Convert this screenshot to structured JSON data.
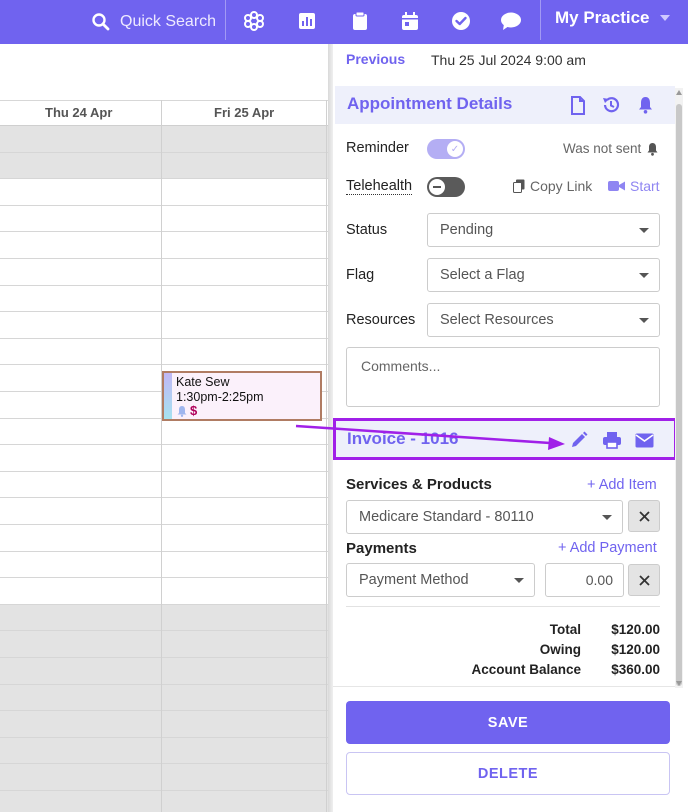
{
  "topbar": {
    "search_label": "Quick Search",
    "practice_label": "My Practice",
    "icons": [
      "modules-icon",
      "reports-icon",
      "clipboard-icon",
      "calendar-icon",
      "check-icon",
      "chat-icon"
    ],
    "color": "#7063ef"
  },
  "calendar": {
    "days": [
      "Thu 24 Apr",
      "Fri 25 Apr"
    ],
    "appointment": {
      "name": "Kate Sew",
      "time": "1:30pm-2:25pm",
      "dollar": "$"
    }
  },
  "panel": {
    "previous_label": "Previous",
    "previous_date": "Thu 25 Jul 2024 9:00 am",
    "appointment_details_title": "Appointment Details",
    "reminder_label": "Reminder",
    "reminder_status": "Was not sent",
    "telehealth_label": "Telehealth",
    "copy_link_label": "Copy Link",
    "start_label": "Start",
    "status_label": "Status",
    "status_value": "Pending",
    "flag_label": "Flag",
    "flag_placeholder": "Select a Flag",
    "resources_label": "Resources",
    "resources_placeholder": "Select Resources",
    "comments_placeholder": "Comments...",
    "invoice_title": "Invoice - 1016",
    "services_label": "Services & Products",
    "add_item_label": "+ Add Item",
    "service_value": "Medicare Standard - 80110",
    "payments_label": "Payments",
    "add_payment_label": "+ Add Payment",
    "payment_method_placeholder": "Payment Method",
    "payment_amount": "0.00",
    "totals": [
      {
        "label": "Total",
        "value": "$120.00"
      },
      {
        "label": "Owing",
        "value": "$120.00"
      },
      {
        "label": "Account Balance",
        "value": "$360.00"
      }
    ],
    "save_label": "SAVE",
    "delete_label": "DELETE",
    "accent": "#7063ef",
    "highlight": "#a020e8"
  }
}
